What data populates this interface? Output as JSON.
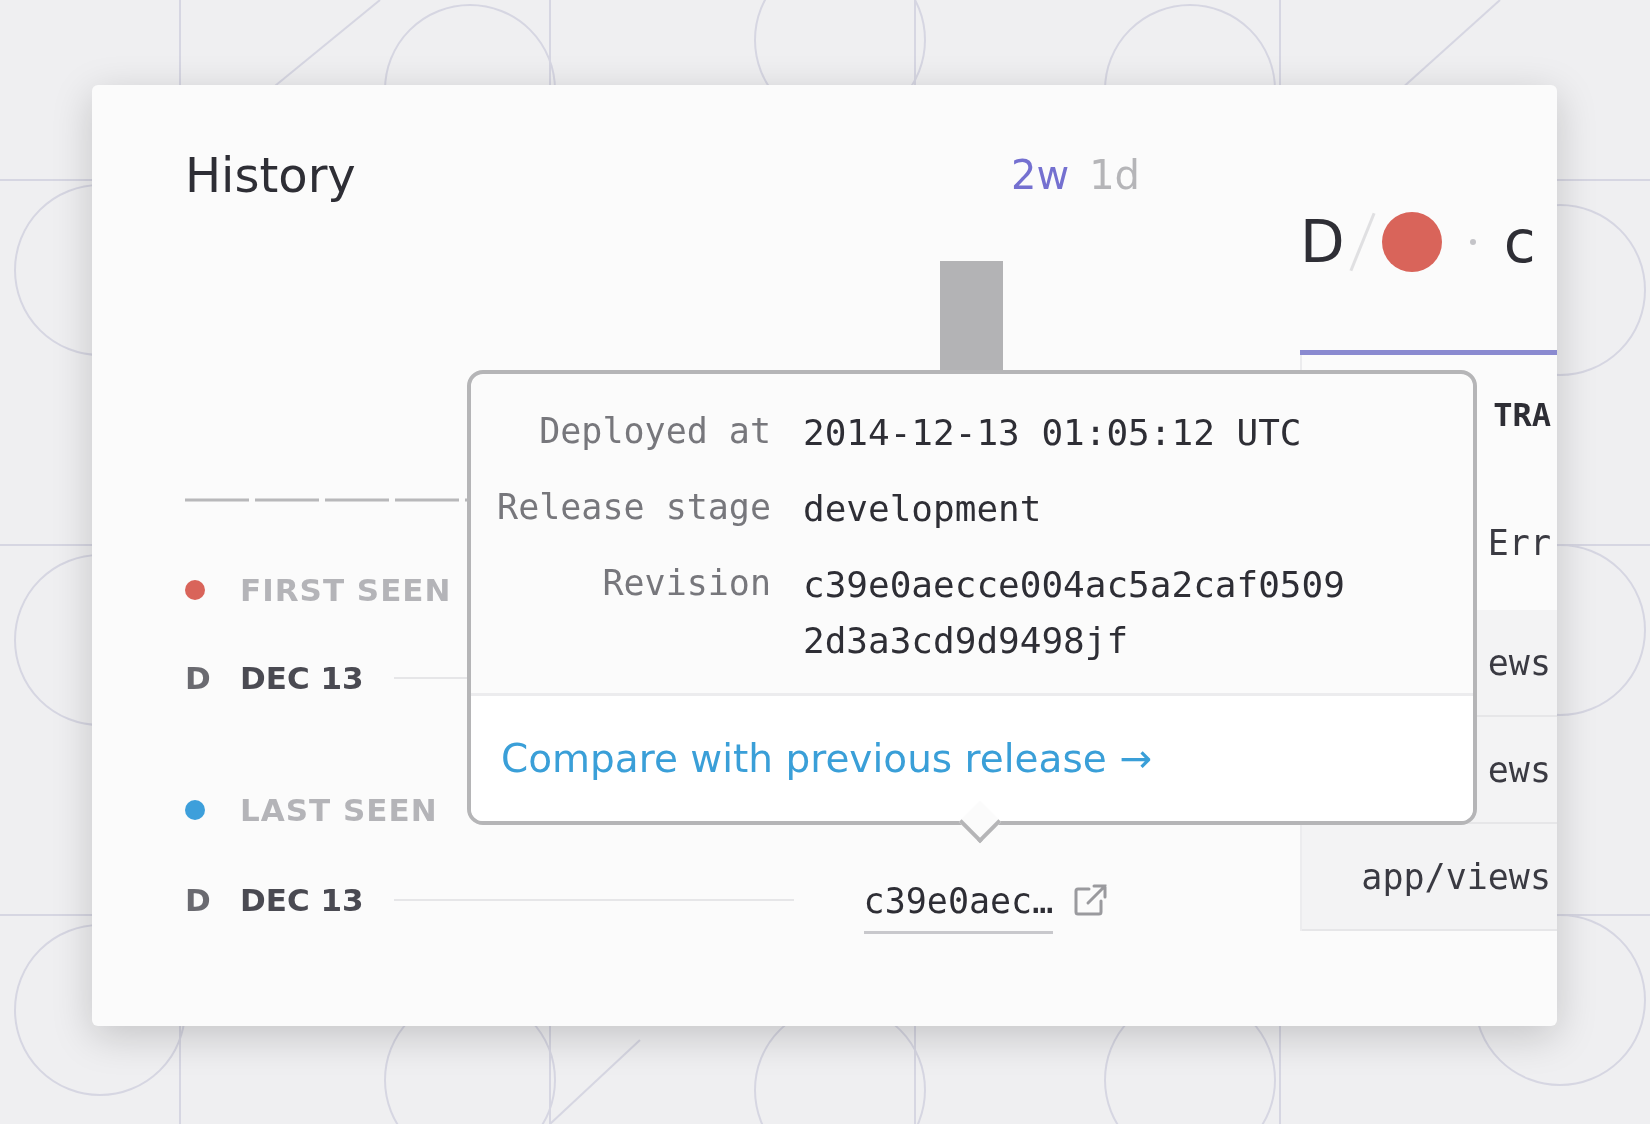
{
  "card": {
    "title": "History",
    "tabs": [
      {
        "label": "2w",
        "selected": true
      },
      {
        "label": "1d",
        "selected": false
      }
    ],
    "events": [
      {
        "label": "FIRST SEEN",
        "color": "#d9645a",
        "day": "D",
        "date": "DEC 13"
      },
      {
        "label": "LAST SEEN",
        "color": "#3d9fdb",
        "day": "D",
        "date": "DEC 13",
        "revision": "c39e0aec…"
      }
    ],
    "tooltip": {
      "fields": [
        {
          "label": "Deployed at",
          "value": "2014-12-13 01:05:12 UTC"
        },
        {
          "label": "Release stage",
          "value": "development"
        },
        {
          "label": "Revision",
          "value": "c39e0aecce004ac5a2caf05092d3a3cd9d9498jf"
        }
      ],
      "link": "Compare with previous release →"
    },
    "detail": {
      "severity": "D",
      "status": {
        "color": "#d9645a"
      },
      "title_fragment": "c",
      "stack_header": "TRA",
      "lines": [
        "Err",
        "ews",
        "ews",
        "app/views"
      ]
    }
  }
}
